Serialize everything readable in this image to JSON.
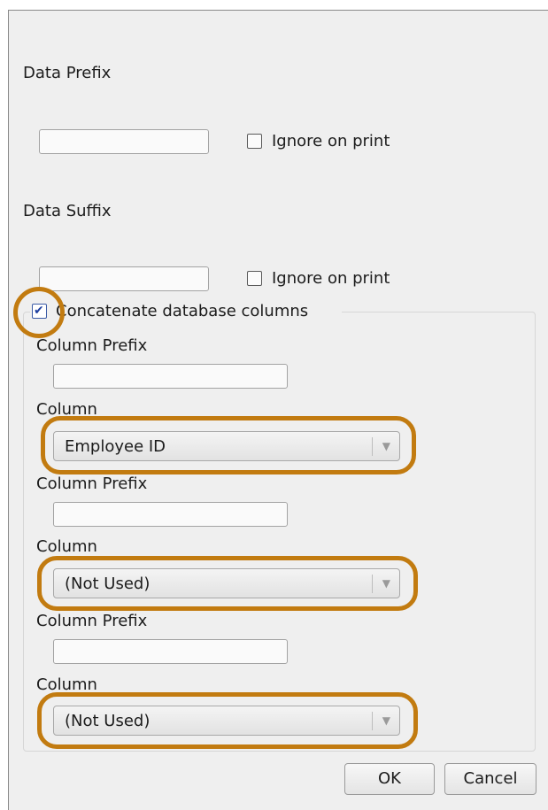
{
  "data_prefix": {
    "label": "Data Prefix",
    "value": "",
    "ignore_on_print": {
      "label": "Ignore on print",
      "checked": false
    }
  },
  "data_suffix": {
    "label": "Data Suffix",
    "value": "",
    "ignore_on_print": {
      "label": "Ignore on print",
      "checked": false
    }
  },
  "concatenate": {
    "label": "Concatenate  database columns",
    "checked": true
  },
  "columns": [
    {
      "prefix_label": "Column Prefix",
      "prefix_value": "",
      "column_label": "Column",
      "column_value": "Employee ID"
    },
    {
      "prefix_label": "Column Prefix",
      "prefix_value": "",
      "column_label": "Column",
      "column_value": "(Not Used)"
    },
    {
      "prefix_label": "Column Prefix",
      "prefix_value": "",
      "column_label": "Column",
      "column_value": "(Not Used)"
    }
  ],
  "buttons": {
    "ok": "OK",
    "cancel": "Cancel"
  },
  "colors": {
    "highlight": "#c27b10",
    "checkbox_tick": "#1d3f9f"
  },
  "icons": {
    "combo_arrow": "chevron-down-icon",
    "check": "checkmark-icon"
  }
}
